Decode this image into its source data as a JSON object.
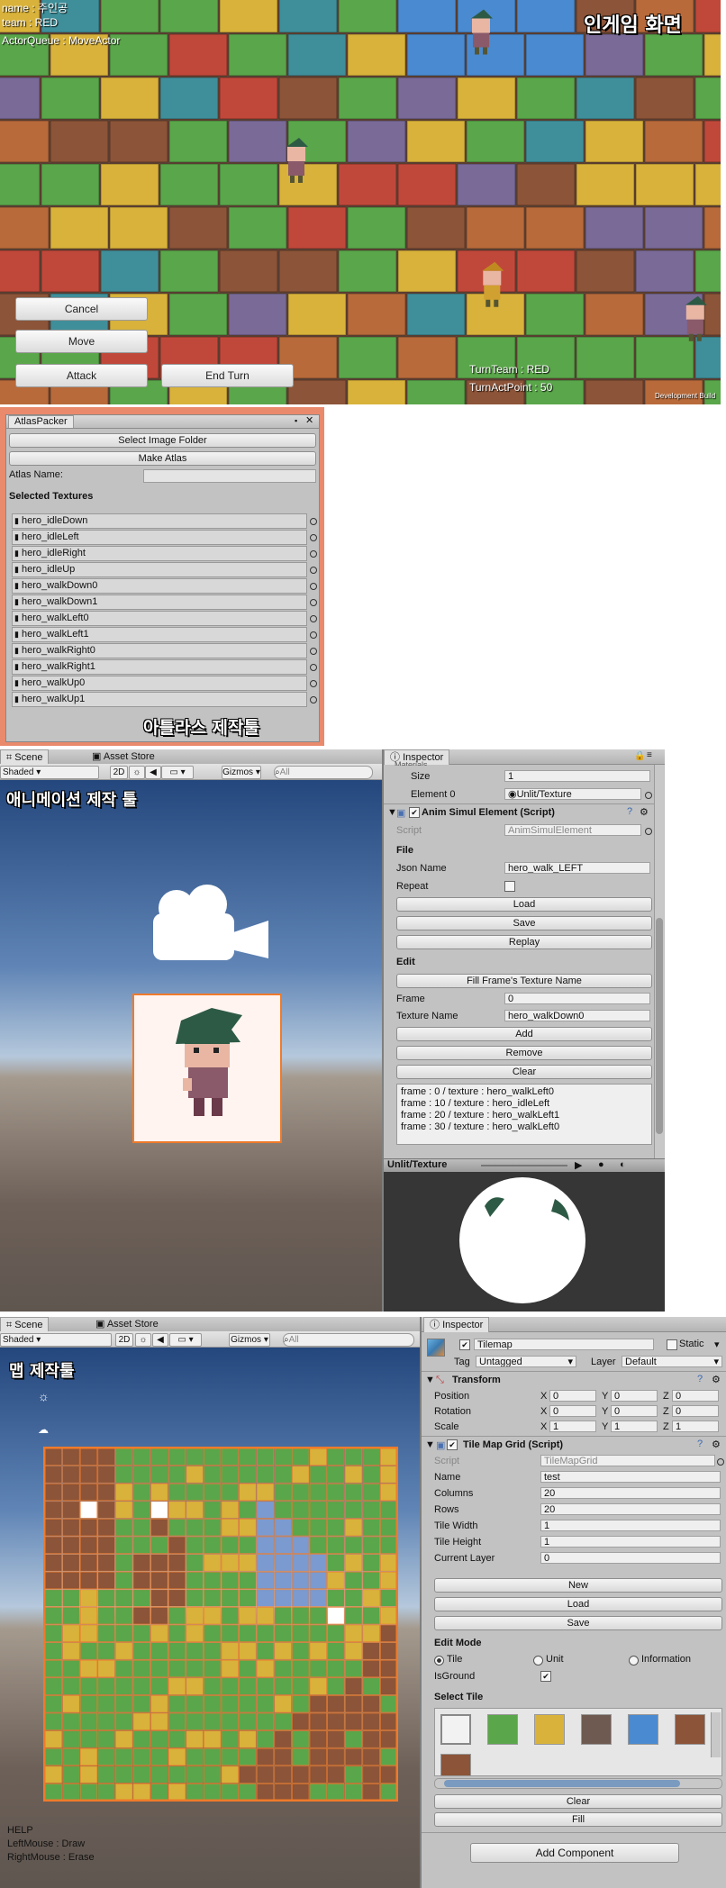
{
  "game": {
    "title": "인게임 화면",
    "status_lines": [
      "name : 주인공",
      "team : RED",
      "ActorQueue : MoveActor"
    ],
    "buttons": {
      "cancel": "Cancel",
      "move": "Move",
      "attack": "Attack",
      "end_turn": "End  Turn"
    },
    "turn_team": "TurnTeam : RED",
    "turn_act_point": "TurnActPoint : 50",
    "dev_build": "Development Build"
  },
  "atlas": {
    "window_title": "AtlasPacker",
    "select_folder": "Select Image Folder",
    "make_atlas": "Make Atlas",
    "atlas_name_label": "Atlas Name:",
    "atlas_name_value": "",
    "selected_textures_header": "Selected Textures",
    "textures": [
      "hero_idleDown",
      "hero_idleLeft",
      "hero_idleRight",
      "hero_idleUp",
      "hero_walkDown0",
      "hero_walkDown1",
      "hero_walkLeft0",
      "hero_walkLeft1",
      "hero_walkRight0",
      "hero_walkRight1",
      "hero_walkUp0",
      "hero_walkUp1"
    ],
    "caption": "아틀라스 제작툴"
  },
  "anim": {
    "tabs": {
      "scene": "Scene",
      "asset_store": "Asset Store",
      "inspector": "Inspector"
    },
    "toolbar": {
      "shaded": "Shaded",
      "mode2d": "2D",
      "gizmos": "Gizmos",
      "search_placeholder": "All"
    },
    "caption": "애니메이션 제작 툴",
    "materials_cutoff": "Materials",
    "size_label": "Size",
    "size_value": "1",
    "element0_label": "Element 0",
    "element0_value": "Unlit/Texture",
    "component_title": "Anim Simul Element (Script)",
    "script_label": "Script",
    "script_value": "AnimSimulElement",
    "file_header": "File",
    "json_name_label": "Json Name",
    "json_name_value": "hero_walk_LEFT",
    "repeat_label": "Repeat",
    "load": "Load",
    "save": "Save",
    "replay": "Replay",
    "edit_header": "Edit",
    "fill_frame": "Fill Frame's Texture Name",
    "frame_label": "Frame",
    "frame_value": "0",
    "texture_name_label": "Texture Name",
    "texture_name_value": "hero_walkDown0",
    "add": "Add",
    "remove": "Remove",
    "clear": "Clear",
    "frames": [
      "frame : 0 / texture : hero_walkLeft0",
      "frame : 10 / texture : hero_idleLeft",
      "frame : 20 / texture : hero_walkLeft1",
      "frame : 30 / texture : hero_walkLeft0"
    ],
    "preview_title": "Unlit/Texture"
  },
  "map": {
    "tabs": {
      "scene": "Scene",
      "asset_store": "Asset Store",
      "inspector": "Inspector"
    },
    "toolbar": {
      "shaded": "Shaded",
      "mode2d": "2D",
      "gizmos": "Gizmos",
      "search_placeholder": "All"
    },
    "caption": "맵 제작툴",
    "help": [
      "HELP",
      "LeftMouse : Draw",
      "RightMouse : Erase"
    ],
    "object_name": "Tilemap",
    "static_label": "Static",
    "tag_label": "Tag",
    "tag_value": "Untagged",
    "layer_label": "Layer",
    "layer_value": "Default",
    "transform_title": "Transform",
    "position_label": "Position",
    "rotation_label": "Rotation",
    "scale_label": "Scale",
    "position": [
      "0",
      "0",
      "0"
    ],
    "rotation": [
      "0",
      "0",
      "0"
    ],
    "scale": [
      "1",
      "1",
      "1"
    ],
    "axes": [
      "X",
      "Y",
      "Z"
    ],
    "component_title": "Tile Map Grid (Script)",
    "script_label": "Script",
    "script_value": "TileMapGrid",
    "name_label": "Name",
    "name_value": "test",
    "columns_label": "Columns",
    "columns_value": "20",
    "rows_label": "Rows",
    "rows_value": "20",
    "tile_width_label": "Tile Width",
    "tile_width_value": "1",
    "tile_height_label": "Tile Height",
    "tile_height_value": "1",
    "current_layer_label": "Current Layer",
    "current_layer_value": "0",
    "new": "New",
    "load": "Load",
    "save": "Save",
    "edit_mode_header": "Edit Mode",
    "mode_tile": "Tile",
    "mode_unit": "Unit",
    "mode_information": "Information",
    "isground_label": "IsGround",
    "select_tile_header": "Select Tile",
    "clear": "Clear",
    "fill": "Fill",
    "add_component": "Add Component"
  },
  "colors": {
    "accent_orange": "#f07a2a",
    "grass": "#5aa64a",
    "dirt": "#8c5438",
    "sand": "#d8b23a",
    "water": "#4a8ad0"
  }
}
